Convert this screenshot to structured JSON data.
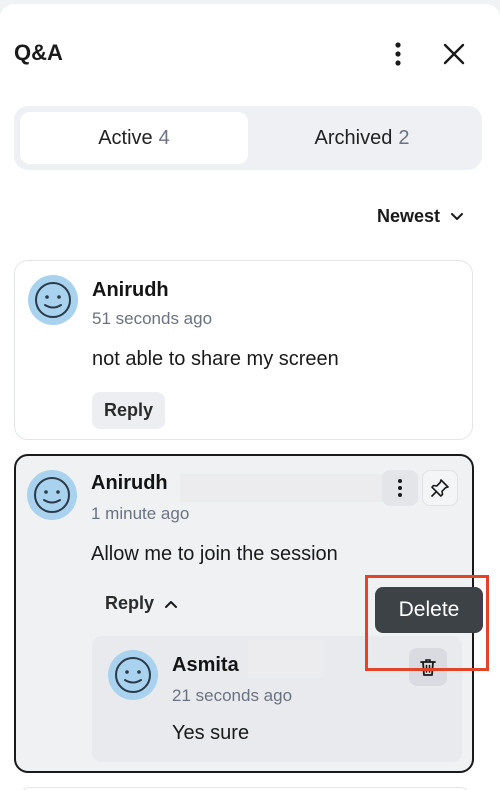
{
  "header": {
    "title": "Q&A",
    "more_icon": "vertical-dots-icon",
    "close_icon": "close-icon"
  },
  "tabs": [
    {
      "label": "Active",
      "count": "4",
      "selected": true
    },
    {
      "label": "Archived",
      "count": "2",
      "selected": false
    }
  ],
  "sort": {
    "label": "Newest",
    "icon": "chevron-down-icon"
  },
  "questions": [
    {
      "author": "Anirudh",
      "time": "51 seconds ago",
      "text": "not able to share my screen",
      "reply_label": "Reply"
    },
    {
      "author": "Anirudh",
      "time": "1 minute ago",
      "text": "Allow me to join the session",
      "reply_label": "Reply",
      "replies": [
        {
          "author": "Asmita",
          "time": "21 seconds ago",
          "text": "Yes sure"
        }
      ]
    }
  ],
  "tooltip": {
    "label": "Delete"
  },
  "colors": {
    "avatar": "#a9d2ee",
    "highlight": "#e0452a",
    "tooltip_bg": "#3c4246"
  }
}
